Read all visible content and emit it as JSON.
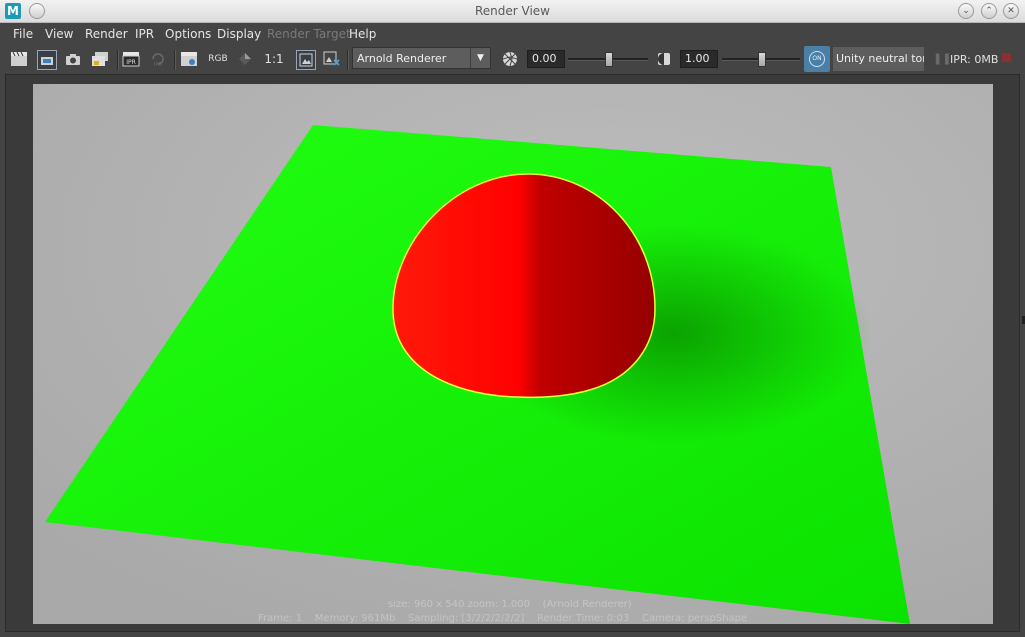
{
  "window": {
    "title": "Render View",
    "app_icon_letter": "M",
    "controls": [
      "minimize",
      "maximize",
      "close"
    ]
  },
  "menu": [
    {
      "label": "File",
      "enabled": true
    },
    {
      "label": "View",
      "enabled": true
    },
    {
      "label": "Render",
      "enabled": true
    },
    {
      "label": "IPR",
      "enabled": true
    },
    {
      "label": "Options",
      "enabled": true
    },
    {
      "label": "Display",
      "enabled": true
    },
    {
      "label": "Render Target",
      "enabled": false
    },
    {
      "label": "Help",
      "enabled": true
    }
  ],
  "toolbar": {
    "icons": [
      "redo-previous-render-icon",
      "render-region-icon",
      "snapshot-icon",
      "render-sequence-icon",
      "ipr-render-icon",
      "refresh-ipr-icon",
      "render-settings-icon",
      "rgb-channels-icon",
      "alpha-channel-icon",
      "real-size-icon",
      "keep-image-icon",
      "remove-image-icon"
    ],
    "rgb_label": "RGB",
    "ratio_label": "1:1",
    "ipr_label": "IPR",
    "renderer": "Arnold Renderer",
    "exposure_value": "0.00",
    "exposure_fraction": 0.5,
    "gamma_value": "1.00",
    "gamma_fraction": 0.5,
    "color_mgmt_label": "ON",
    "view_transform": "Unity neutral tone-",
    "ipr_status": "IPR: 0MB"
  },
  "render": {
    "colors": {
      "background": "#b5b5b5",
      "plane": "#12ff00",
      "sphere_lit": "#ff0000",
      "sphere_shadow": "#990000",
      "sphere_rim": "#e6ff3c"
    }
  },
  "status": {
    "line1": "size: 960 x 540 zoom: 1.000    (Arnold Renderer)",
    "line2": "Frame: 1    Memory: 961Mb    Sampling: [3/2/2/2/2/2]    Render Time: 0:03    Camera: perspShape"
  }
}
